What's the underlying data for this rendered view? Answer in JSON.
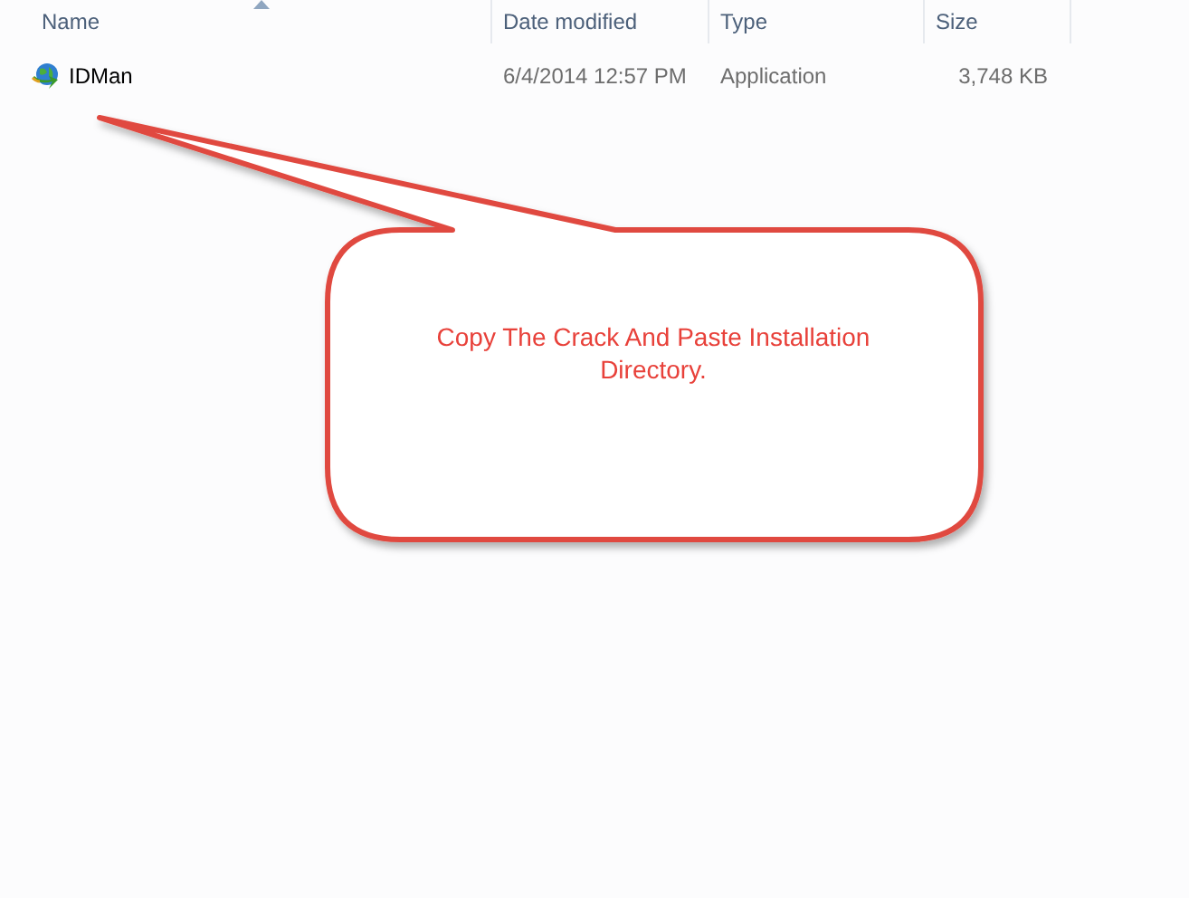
{
  "columns": [
    {
      "label": "Name",
      "sorted": true
    },
    {
      "label": "Date modified",
      "sorted": false
    },
    {
      "label": "Type",
      "sorted": false
    },
    {
      "label": "Size",
      "sorted": false
    }
  ],
  "rows": [
    {
      "name": "IDMan",
      "date": "6/4/2014 12:57 PM",
      "type": "Application",
      "size": "3,748 KB"
    }
  ],
  "callout": {
    "text": "Copy The Crack And Paste Installation Directory."
  }
}
